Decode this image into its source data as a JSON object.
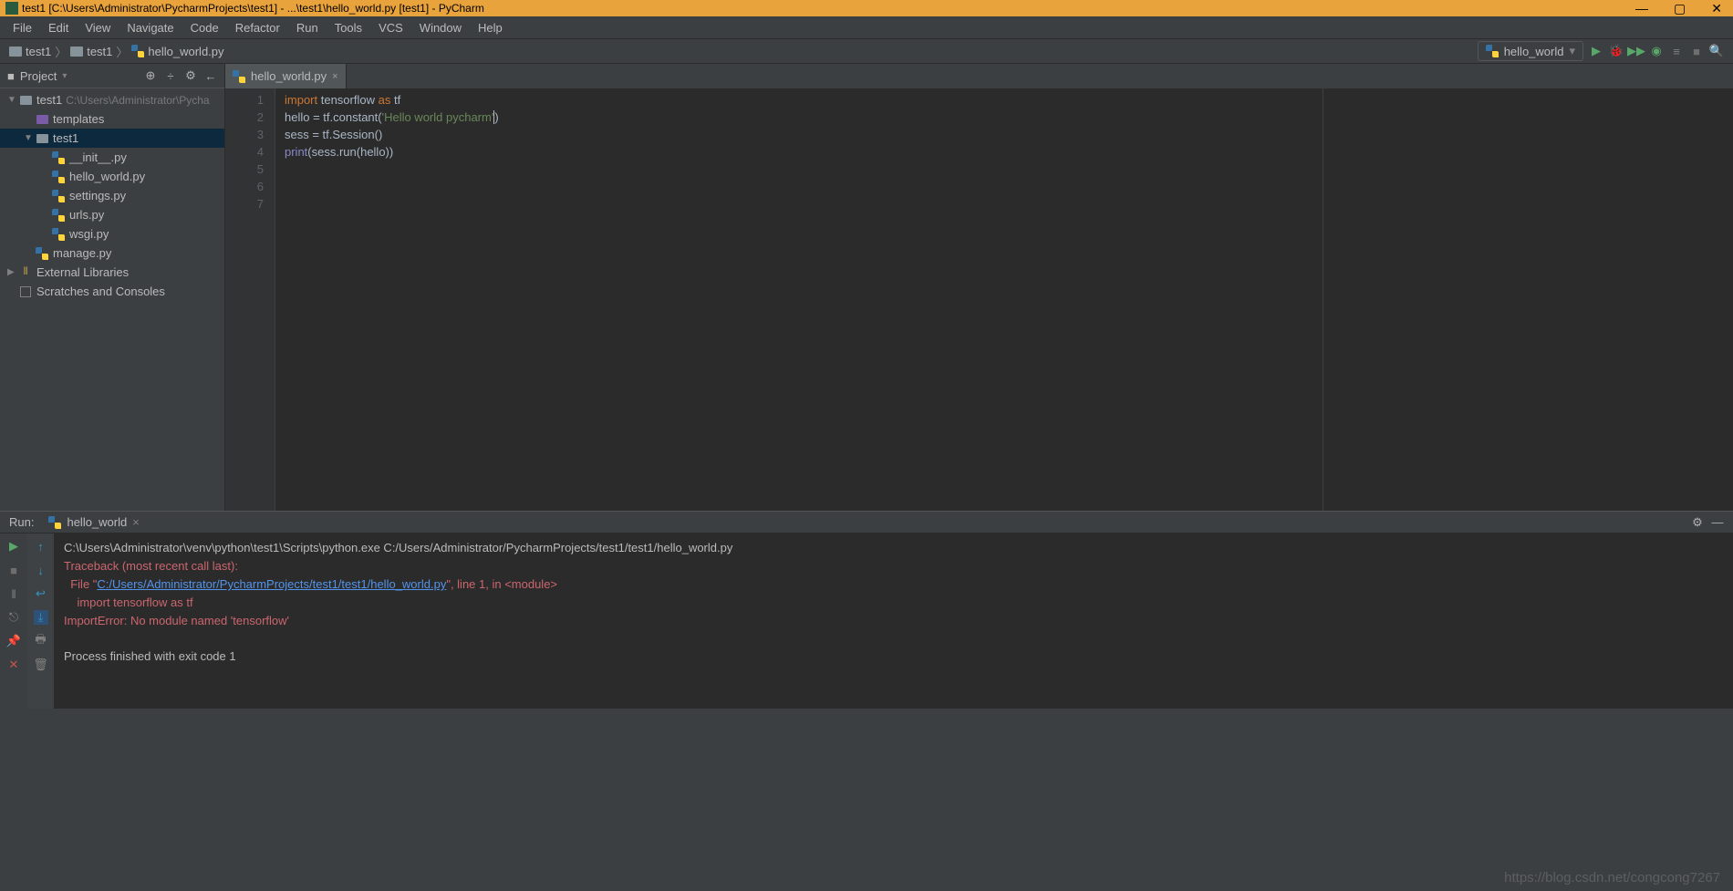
{
  "title": "test1 [C:\\Users\\Administrator\\PycharmProjects\\test1] - ...\\test1\\hello_world.py [test1] - PyCharm",
  "menu": [
    "File",
    "Edit",
    "View",
    "Navigate",
    "Code",
    "Refactor",
    "Run",
    "Tools",
    "VCS",
    "Window",
    "Help"
  ],
  "breadcrumbs": [
    {
      "icon": "folder",
      "label": "test1"
    },
    {
      "icon": "folder",
      "label": "test1"
    },
    {
      "icon": "python",
      "label": "hello_world.py"
    }
  ],
  "run_config": "hello_world",
  "project_panel": {
    "title": "Project",
    "tree": [
      {
        "level": 0,
        "arrow": "▼",
        "icon": "folder",
        "label": "test1",
        "path": "C:\\Users\\Administrator\\Pycha"
      },
      {
        "level": 1,
        "arrow": "",
        "icon": "folder-purple",
        "label": "templates"
      },
      {
        "level": 1,
        "arrow": "▼",
        "icon": "folder",
        "label": "test1",
        "selected": true
      },
      {
        "level": 2,
        "arrow": "",
        "icon": "python",
        "label": "__init__.py"
      },
      {
        "level": 2,
        "arrow": "",
        "icon": "python",
        "label": "hello_world.py"
      },
      {
        "level": 2,
        "arrow": "",
        "icon": "python",
        "label": "settings.py"
      },
      {
        "level": 2,
        "arrow": "",
        "icon": "python",
        "label": "urls.py"
      },
      {
        "level": 2,
        "arrow": "",
        "icon": "python",
        "label": "wsgi.py"
      },
      {
        "level": 1,
        "arrow": "",
        "icon": "python",
        "label": "manage.py"
      },
      {
        "level": 0,
        "arrow": "▶",
        "icon": "lib",
        "label": "External Libraries"
      },
      {
        "level": 0,
        "arrow": "",
        "icon": "scratch",
        "label": "Scratches and Consoles"
      }
    ]
  },
  "editor": {
    "tab_name": "hello_world.py",
    "gutter": [
      "1",
      "2",
      "3",
      "4",
      "5",
      "6",
      "7"
    ],
    "code": {
      "l1_kw": "import",
      "l1_rest": " tensorflow ",
      "l1_as": "as",
      "l1_tf": " tf",
      "l2_a": "hello = tf.constant(",
      "l2_str": "'Hello world pycharm'",
      "l2_b": ")",
      "l3": "sess = tf.Session()",
      "l4_print": "print",
      "l4_rest": "(sess.run(hello))"
    }
  },
  "run": {
    "label": "Run:",
    "tab": "hello_world",
    "console": {
      "cmd": "C:\\Users\\Administrator\\venv\\python\\test1\\Scripts\\python.exe C:/Users/Administrator/PycharmProjects/test1/test1/hello_world.py",
      "tb": "Traceback (most recent call last):",
      "file_a": "  File \"",
      "file_link": "C:/Users/Administrator/PycharmProjects/test1/test1/hello_world.py",
      "file_b": "\", line 1, in <module>",
      "imp": "    import tensorflow as tf",
      "err": "ImportError: No module named 'tensorflow'",
      "exit": "Process finished with exit code 1"
    }
  },
  "watermark": "https://blog.csdn.net/congcong7267"
}
